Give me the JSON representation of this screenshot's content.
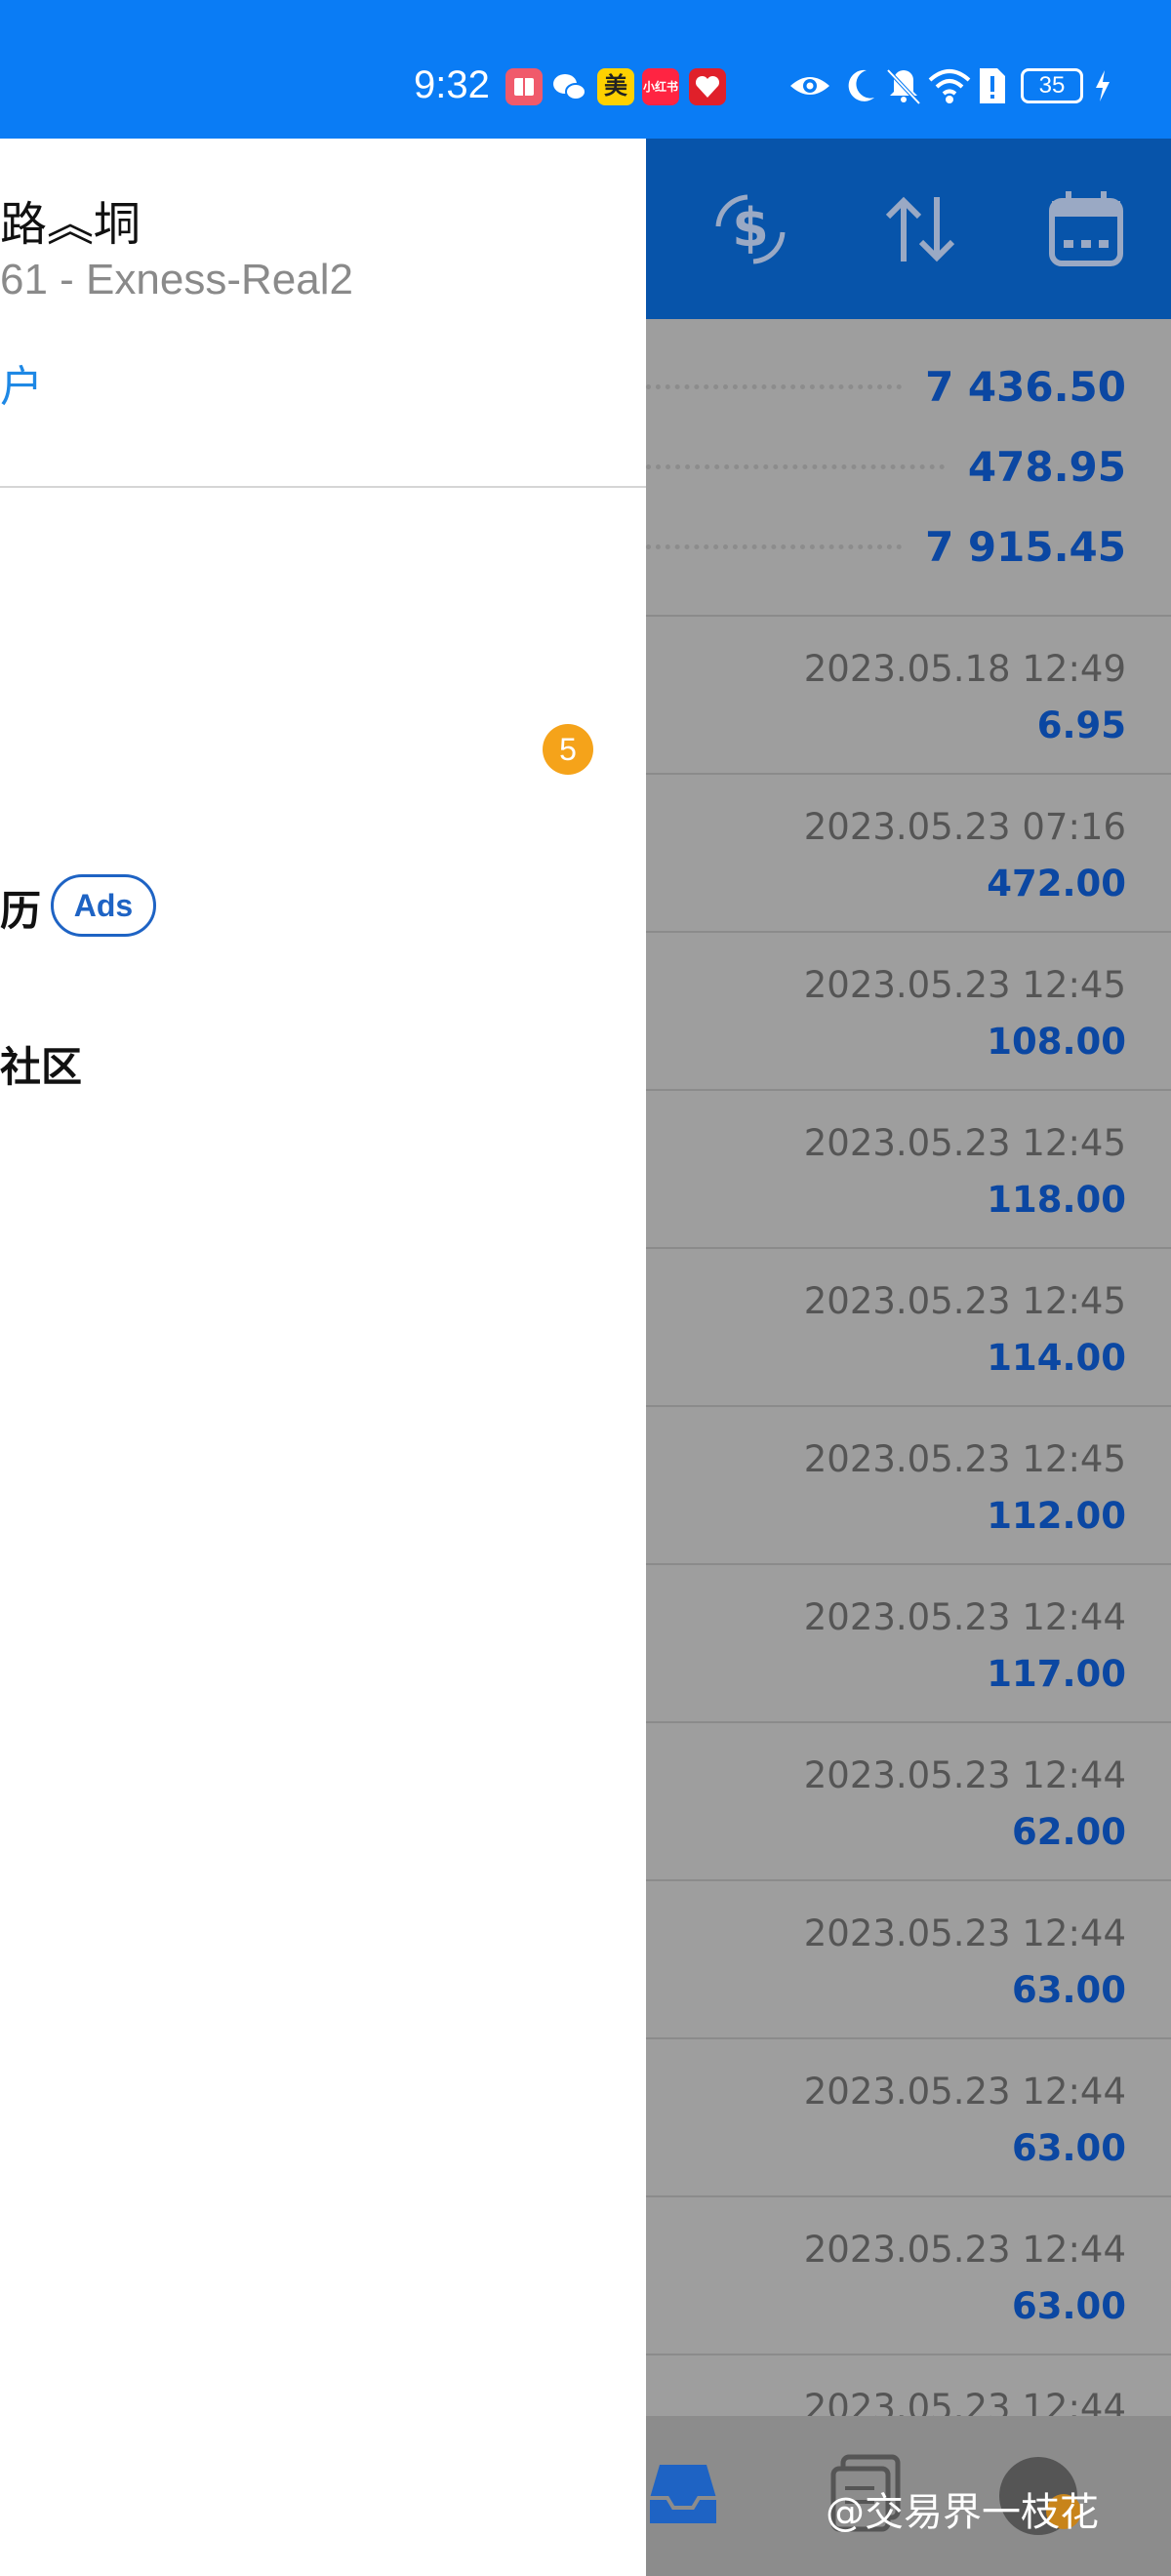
{
  "status_bar": {
    "time": "9:32",
    "app_icons": [
      "book-app-icon",
      "wechat-icon",
      "meituan-icon",
      "xiaohongshu-icon",
      "health-app-icon"
    ],
    "meituan_label": "美",
    "xhs_label": "小红书",
    "battery": "35"
  },
  "header": {
    "icons": [
      "currency-exchange-icon",
      "sort-icon",
      "calendar-icon"
    ]
  },
  "summary": {
    "values": [
      "7 436.50",
      "478.95",
      "7 915.45"
    ]
  },
  "deals": [
    {
      "time": "2023.05.18 12:49",
      "amount": "6.95"
    },
    {
      "time": "2023.05.23 07:16",
      "amount": "472.00"
    },
    {
      "time": "2023.05.23 12:45",
      "amount": "108.00"
    },
    {
      "time": "2023.05.23 12:45",
      "amount": "118.00"
    },
    {
      "time": "2023.05.23 12:45",
      "amount": "114.00"
    },
    {
      "time": "2023.05.23 12:45",
      "amount": "112.00"
    },
    {
      "time": "2023.05.23 12:44",
      "amount": "117.00"
    },
    {
      "time": "2023.05.23 12:44",
      "amount": "62.00"
    },
    {
      "time": "2023.05.23 12:44",
      "amount": "63.00"
    },
    {
      "time": "2023.05.23 12:44",
      "amount": "63.00"
    },
    {
      "time": "2023.05.23 12:44",
      "amount": "63.00"
    },
    {
      "time": "2023.05.23 12:44",
      "amount": ""
    }
  ],
  "drawer": {
    "name": "路︽垌",
    "account": "61 - Exness-Real2",
    "manage_link": "户",
    "badge": "5",
    "item_calendar": "历",
    "ads_label": "Ads",
    "item_community": "社区"
  },
  "watermark": "@交易界一枝花",
  "colors": {
    "status_bar": "#0a7cf5",
    "header": "#0754aa",
    "value_blue": "#0b47a2",
    "badge": "#f5a31a",
    "link_blue": "#1e88e5"
  }
}
